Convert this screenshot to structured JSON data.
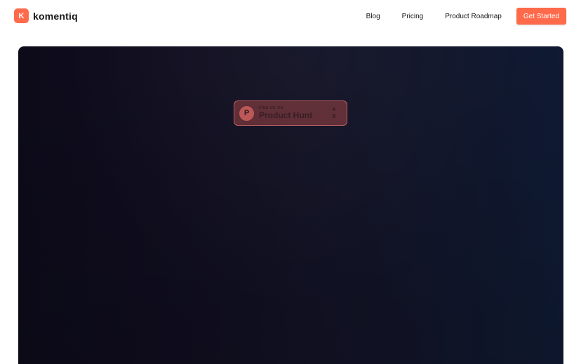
{
  "header": {
    "logo_letter": "K",
    "brand_name": "komentiq",
    "nav": [
      {
        "label": "Blog"
      },
      {
        "label": "Pricing"
      },
      {
        "label": "Product Roadmap"
      }
    ],
    "cta_label": "Get Started"
  },
  "hero": {
    "product_hunt": {
      "kicker": "FIND US ON",
      "title": "Product Hunt",
      "upvote_icon": "triangle-up",
      "votes": "8"
    }
  },
  "colors": {
    "accent": "#ff6a4b",
    "hero_left": "#0d0b1a",
    "hero_right": "#0f1a33",
    "badge_fill": "#aa4848"
  }
}
